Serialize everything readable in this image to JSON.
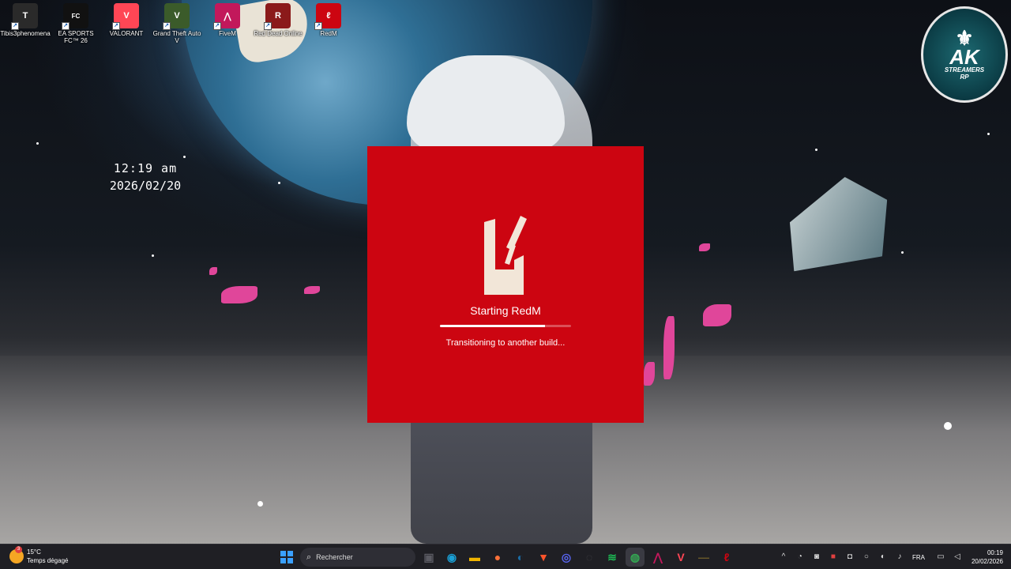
{
  "desktop": {
    "icons": [
      {
        "label": "Tibis3phenomena",
        "icon": "tibis-app-icon",
        "color": "#2a2a2a"
      },
      {
        "label": "EA SPORTS FC™ 26",
        "icon": "ea-fc-icon",
        "color": "#111111"
      },
      {
        "label": "VALORANT",
        "icon": "valorant-icon",
        "color": "#ff4655"
      },
      {
        "label": "Grand Theft Auto V",
        "icon": "gta-v-icon",
        "color": "#3b5b2a"
      },
      {
        "label": "FiveM",
        "icon": "fivem-icon",
        "color": "#c2185b"
      },
      {
        "label": "Red Dead Online",
        "icon": "red-dead-online-icon",
        "color": "#8b1a1a"
      },
      {
        "label": "RedM",
        "icon": "redm-icon",
        "color": "#cc0511"
      }
    ],
    "clock": {
      "time": "12:19 am",
      "date": "2026/02/20"
    },
    "badge": {
      "main": "AK",
      "sub1": "STREAMERS",
      "sub2": "RP"
    }
  },
  "splash": {
    "title": "Starting RedM",
    "status": "Transitioning to another build...",
    "progress": 0.8,
    "color": "#cc0511",
    "logo_color": "#f2e6d8"
  },
  "taskbar": {
    "weather": {
      "temp": "15°C",
      "desc": "Temps dégagé",
      "badge": "3"
    },
    "search_placeholder": "Rechercher",
    "apps": [
      {
        "name": "task-view",
        "glyph": "▣",
        "color": "#5a5a62"
      },
      {
        "name": "edge",
        "glyph": "◉",
        "color": "#1aa0d6"
      },
      {
        "name": "file-explorer",
        "glyph": "▬",
        "color": "#f0b400"
      },
      {
        "name": "firefox",
        "glyph": "●",
        "color": "#ff7139"
      },
      {
        "name": "steam",
        "glyph": "◐",
        "color": "#1b6ea8"
      },
      {
        "name": "brave",
        "glyph": "▼",
        "color": "#fb542b"
      },
      {
        "name": "discord",
        "glyph": "◎",
        "color": "#5865f2"
      },
      {
        "name": "github",
        "glyph": "◌",
        "color": "#444448"
      },
      {
        "name": "spotify",
        "glyph": "≋",
        "color": "#1db954"
      },
      {
        "name": "chrome",
        "glyph": "◍",
        "color": "#34a853"
      },
      {
        "name": "fivem",
        "glyph": "⋀",
        "color": "#c2185b"
      },
      {
        "name": "valorant",
        "glyph": "V",
        "color": "#ff4655"
      },
      {
        "name": "gta",
        "glyph": "—",
        "color": "#6b5a2a"
      },
      {
        "name": "redm",
        "glyph": "ℓ",
        "color": "#cc0511"
      }
    ],
    "language": "FRA",
    "time": "00:19",
    "date": "20/02/2026"
  }
}
